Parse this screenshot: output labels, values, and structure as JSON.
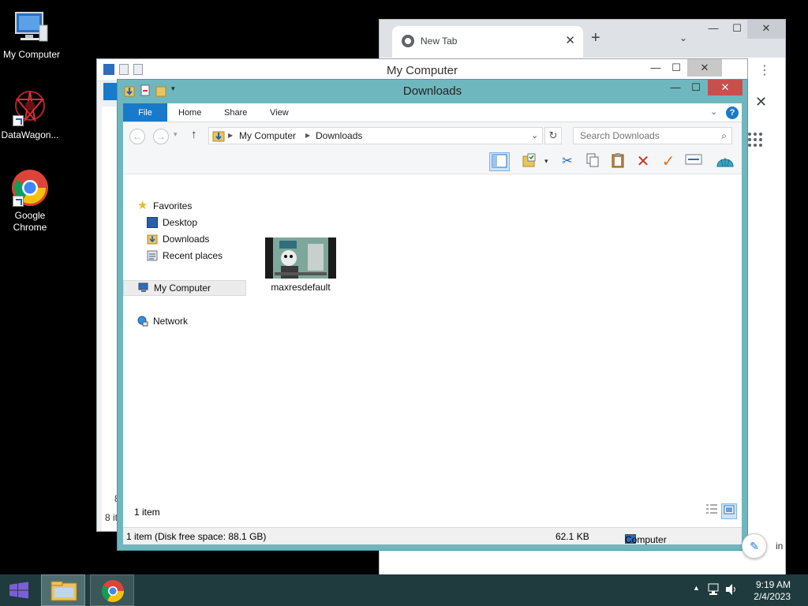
{
  "desktop": {
    "icons": [
      {
        "label": "My Computer",
        "icon": "computer-icon"
      },
      {
        "label": "DataWagon...",
        "icon": "datawagon-icon"
      },
      {
        "label": "Google Chrome",
        "icon": "chrome-icon"
      }
    ]
  },
  "chrome": {
    "tab_title": "New Tab",
    "tab_close": "✕",
    "new_tab": "+",
    "tab_search": "⌄",
    "minimize": "—",
    "maximize": "☐",
    "close": "✕",
    "side_close": "✕",
    "partial_text": "in"
  },
  "my_computer_window": {
    "title": "My Computer",
    "minimize": "—",
    "maximize": "☐",
    "close": "✕",
    "status_partial": "8 it",
    "side_partial": "8"
  },
  "downloads_window": {
    "title": "Downloads",
    "minimize": "—",
    "maximize": "☐",
    "close": "✕",
    "ribbon_tabs": [
      "File",
      "Home",
      "Share",
      "View"
    ],
    "address": {
      "root": "My Computer",
      "current": "Downloads"
    },
    "search_placeholder": "Search Downloads",
    "navigation": {
      "favorites": "Favorites",
      "desktop": "Desktop",
      "downloads": "Downloads",
      "recent": "Recent places",
      "computer": "My Computer",
      "network": "Network"
    },
    "files": [
      {
        "name": "maxresdefault"
      }
    ],
    "item_count": "1 item",
    "status": {
      "left": "1 item (Disk free space: 88.1 GB)",
      "size": "62.1 KB",
      "location": "Computer"
    }
  },
  "taskbar": {
    "time": "9:19 AM",
    "date": "2/4/2023"
  },
  "colors": {
    "explorer_frame": "#6fb7bf",
    "file_tab": "#1979ca",
    "close_red": "#c7504c",
    "taskbar": "#1f3b3e"
  }
}
